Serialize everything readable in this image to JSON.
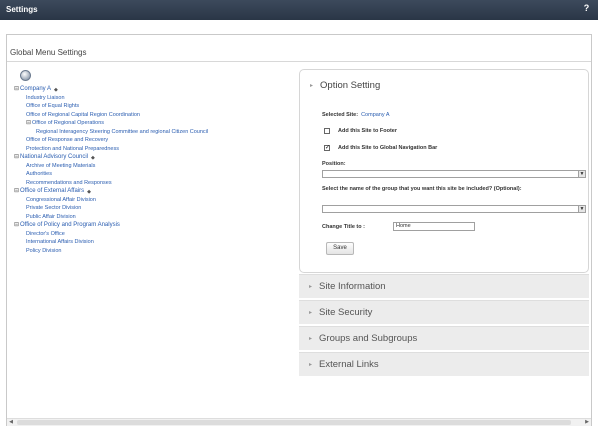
{
  "window": {
    "title": "Settings",
    "help_glyph": "?"
  },
  "panel": {
    "title": "Global Menu Settings"
  },
  "tree": [
    {
      "label": "Company A",
      "expander": "⊟",
      "level": 0,
      "pin": true
    },
    {
      "label": "Industry Liaison",
      "level": 1
    },
    {
      "label": "Office of Equal Rights",
      "level": 1
    },
    {
      "label": "Office of Regional Capital Region Coordination",
      "level": 1
    },
    {
      "label": "Office of Regional Operations",
      "expander": "⊟",
      "level": 1
    },
    {
      "label": "Regional Interagency Steering Committee and regional Citizen Council",
      "level": 2
    },
    {
      "label": "Office of Response and Recovery",
      "level": 1
    },
    {
      "label": "Protection and National Preparedness",
      "level": 1
    },
    {
      "label": "National Advisory Council",
      "expander": "⊟",
      "level": 0,
      "pin": true
    },
    {
      "label": "Archive of Meeting Materials",
      "level": 1
    },
    {
      "label": "Authorities",
      "level": 1
    },
    {
      "label": "Recommendations and Responses",
      "level": 1
    },
    {
      "label": "Office of External Affairs",
      "expander": "⊟",
      "level": 0,
      "pin": true
    },
    {
      "label": "Congressional Affair Division",
      "level": 1
    },
    {
      "label": "Private Sector Division",
      "level": 1
    },
    {
      "label": "Public Affair Division",
      "level": 1
    },
    {
      "label": "Office of Policy and Program Analysis",
      "expander": "⊟",
      "level": 0
    },
    {
      "label": "Director's Office",
      "level": 1
    },
    {
      "label": "International Affairs Division",
      "level": 1
    },
    {
      "label": "Policy Division",
      "level": 1
    }
  ],
  "option_setting": {
    "heading": "Option Setting",
    "selected_site_label": "Selected Site:",
    "selected_site_value": "Company A",
    "add_footer_label": "Add this Site to Footer",
    "add_footer_checked": false,
    "add_global_nav_label": "Add this Site to Global Navigation Bar",
    "add_global_nav_checked": true,
    "checkmark_glyph": "✓",
    "position_label": "Position:",
    "group_label": "Select the name of the group that you want this site be included? (Optional):",
    "change_title_label": "Change Title to :",
    "change_title_value": "Home",
    "save_label": "Save"
  },
  "sections": [
    {
      "heading": "Site Information"
    },
    {
      "heading": "Site Security"
    },
    {
      "heading": "Groups and Subgroups"
    },
    {
      "heading": "External Links"
    }
  ]
}
